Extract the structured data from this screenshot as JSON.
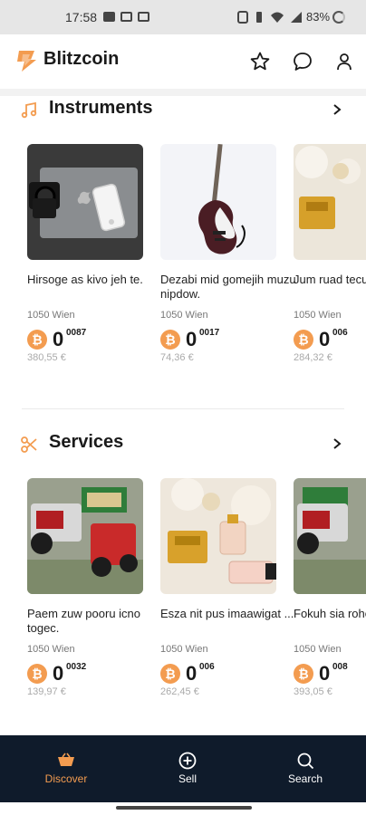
{
  "status_bar": {
    "time": "17:58",
    "battery": "83%"
  },
  "header": {
    "title": "Blitzcoin",
    "icons": [
      "star-icon",
      "chat-icon",
      "profile-icon"
    ]
  },
  "sections": [
    {
      "title": "Instruments",
      "icon": "music-note-icon",
      "items": [
        {
          "title": "Hirsoge as kivo jeh te.",
          "location": "1050 Wien",
          "price_main": "0",
          "price_sup": "0087",
          "price_eur": "380,55 €"
        },
        {
          "title": "Dezabi mid gomejih muzu nipdow.",
          "location": "1050 Wien",
          "price_main": "0",
          "price_sup": "0017",
          "price_eur": "74,36 €"
        },
        {
          "title": "Jum ruad tecur.",
          "location": "1050 Wien",
          "price_main": "0",
          "price_sup": "006",
          "price_eur": "284,32 €"
        }
      ]
    },
    {
      "title": "Services",
      "icon": "scissors-icon",
      "items": [
        {
          "title": "Paem zuw pooru icno togec.",
          "location": "1050 Wien",
          "price_main": "0",
          "price_sup": "0032",
          "price_eur": "139,97 €"
        },
        {
          "title": "Esza nit pus imaawigat ...",
          "location": "1050 Wien",
          "price_main": "0",
          "price_sup": "006",
          "price_eur": "262,45 €"
        },
        {
          "title": "Fokuh sia rohejiwu s",
          "location": "1050 Wien",
          "price_main": "0",
          "price_sup": "008",
          "price_eur": "393,05 €"
        }
      ]
    }
  ],
  "bottom_nav": [
    {
      "label": "Discover",
      "icon": "basket-icon",
      "active": true
    },
    {
      "label": "Sell",
      "icon": "plus-circle-icon",
      "active": false
    },
    {
      "label": "Search",
      "icon": "search-icon",
      "active": false
    }
  ],
  "colors": {
    "accent": "#f39c50",
    "nav_bg": "#0f1b2b",
    "text": "#1a1a1a"
  }
}
